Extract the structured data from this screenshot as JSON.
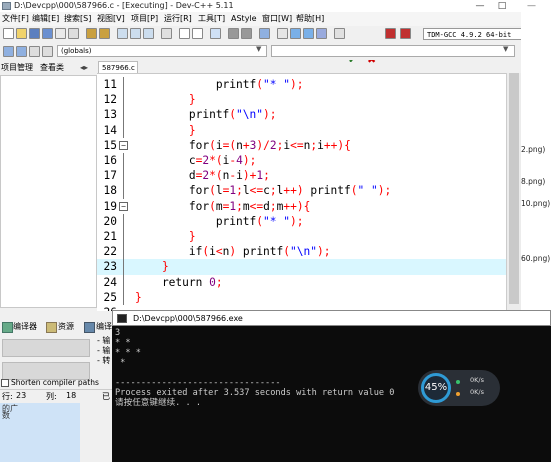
{
  "window": {
    "title": "D:\\Devcpp\\000\\587966.c - [Executing] - Dev-C++ 5.11",
    "controls": [
      "—",
      "□",
      "✕"
    ]
  },
  "menu": [
    "文件[F]",
    "编辑[E]",
    "搜索[S]",
    "视图[V]",
    "项目[P]",
    "运行[R]",
    "工具[T]",
    "AStyle",
    "窗口[W]",
    "帮助[H]"
  ],
  "toolbar": {
    "compiler": "TDM-GCC 4.9.2 64-bit",
    "scope": "(globals)"
  },
  "left_panel": {
    "tabs": [
      "项目管理",
      "查看类"
    ]
  },
  "editor": {
    "file_tab": "587966.c",
    "lines": [
      {
        "n": "11",
        "text": "            printf(\"* \");"
      },
      {
        "n": "12",
        "text": "        }"
      },
      {
        "n": "13",
        "text": "        printf(\"\\n\");"
      },
      {
        "n": "14",
        "text": "        }"
      },
      {
        "n": "15",
        "text": "        for(i=(n+3)/2;i<=n;i++){"
      },
      {
        "n": "16",
        "text": "        c=2*(i-4);"
      },
      {
        "n": "17",
        "text": "        d=2*(n-i)+1;"
      },
      {
        "n": "18",
        "text": "        for(l=1;l<=c;l++) printf(\" \");"
      },
      {
        "n": "19",
        "text": "        for(m=1;m<=d;m++){"
      },
      {
        "n": "20",
        "text": "            printf(\"* \");"
      },
      {
        "n": "21",
        "text": "        }"
      },
      {
        "n": "22",
        "text": "        if(i<n) printf(\"\\n\");"
      },
      {
        "n": "23",
        "text": "    }"
      },
      {
        "n": "24",
        "text": "    return 0;"
      },
      {
        "n": "25",
        "text": "}"
      },
      {
        "n": "26",
        "text": ""
      }
    ]
  },
  "background_window": {
    "items": [
      "2.png)",
      "8.png)",
      "10.png)",
      "60.png)"
    ]
  },
  "bottom_panel": {
    "tabs": [
      "编译器",
      "资源",
      "编译"
    ],
    "output_lines": [
      "- 输",
      "- 输",
      "- 转"
    ],
    "checkbox_label": "Shorten compiler paths",
    "status": {
      "row_label": "行:",
      "row": "23",
      "col_label": "列:",
      "col": "18",
      "sel_label": "已"
    },
    "extra": [
      "的广",
      "数"
    ]
  },
  "console": {
    "title": "D:\\Devcpp\\000\\587966.exe",
    "lines": [
      "3",
      "* *",
      "* * *",
      " *",
      "",
      "--------------------------------",
      "Process exited after 3.537 seconds with return value 0",
      "请按任意键继续. . ."
    ]
  },
  "net_widget": {
    "cpu": "45%",
    "up": "0K/s",
    "down": "0K/s"
  }
}
